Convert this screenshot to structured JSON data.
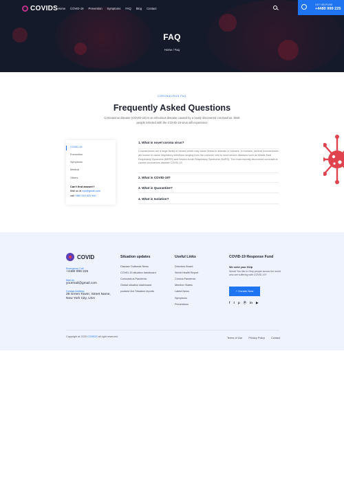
{
  "header": {
    "logo_text": "COVIDS",
    "menu": [
      "Home",
      "COVID-19",
      "Prevention",
      "Symptoms",
      "FAQ",
      "Blog",
      "Contact"
    ],
    "helpline_label": "24/7 HELPLINE",
    "helpline_number": "+4480 999 225"
  },
  "hero": {
    "title": "FAQ",
    "breadcrumb_home": "Home",
    "breadcrumb_sep": "/",
    "breadcrumb_current": "Faq"
  },
  "faq": {
    "subtitle": "CORONAVIRUS FAQ",
    "title": "Frequently Asked Questions",
    "description": "Coronavirus disease (COVID-19) is an infectious disease caused by a newly discovered coronavirus. Most people infected with the COVID-19 virus will experience"
  },
  "sidebar": {
    "items": [
      "COVID-19",
      "Prevention",
      "Symptoms",
      "Medical",
      "Others"
    ],
    "help_title": "Can't find answer?",
    "mail_label": "Mail us at",
    "mail_value": "cys@gmail.com",
    "call_label": "call",
    "call_value": "+880 924 820 940"
  },
  "accordion": [
    {
      "question": "1. What is novel corona virus?",
      "answer": "Coronaviruses are a large family of viruses which may cause illness in animals or humans. In humans, several coronaviruses are known to cause respiratory infections ranging from the common cold to more severe diseases such as Middle East Respiratory Syndrome (MERS) and Severe Acute Respiratory Syndrome (SARS). The most recently discovered coronavirus causes coronavirus disease COVID-19."
    },
    {
      "question": "2. What is COVID-19?"
    },
    {
      "question": "3. What is Quarantine?"
    },
    {
      "question": "4. What is Isolation?"
    }
  ],
  "footer": {
    "logo_text": "COVID",
    "emergency_label": "Emergency Call",
    "emergency_value": "+4480 999 225",
    "mail_label": "Mail Us",
    "mail_value": "yourmail@gmail.com",
    "address_label": "Contact Address",
    "address_value": "28 Green Tower, Street Name, New York City, USA",
    "col1_title": "Situation updates",
    "col1_links": [
      "Disease Outbreak News",
      "COVID-19 situation dashboard",
      "Coronavirus Pandemic",
      "Global situation dashboard",
      "youtube live Situation reports"
    ],
    "col2_title": "Useful Links",
    "col2_links": [
      "Directors Board",
      "World Health Report",
      "Corona Pandemic",
      "Member States",
      "Latest News",
      "Symptoms",
      "Preventions"
    ],
    "col3_title": "COVID-19 Response Fund",
    "fund_need": "We need your Help",
    "fund_text": "Would You like to Help people across the world who are suffering with COVID-19?",
    "donate_label": "+ Donate Now",
    "socials": [
      "f",
      "t",
      "p",
      "Ⓟ",
      "in",
      "▶"
    ],
    "copyright_prefix": "Copyright at 2020",
    "copyright_brand": "COVIDS",
    "copyright_suffix": "all right reserved.",
    "bottom_links": [
      "Terms of Use",
      "Privacy Policy",
      "Contact"
    ]
  },
  "colors": {
    "accent": "#1e74f1",
    "hero_bg": "#141a2a",
    "footer_bg": "#eef3fd",
    "virus": "#e0434e"
  }
}
